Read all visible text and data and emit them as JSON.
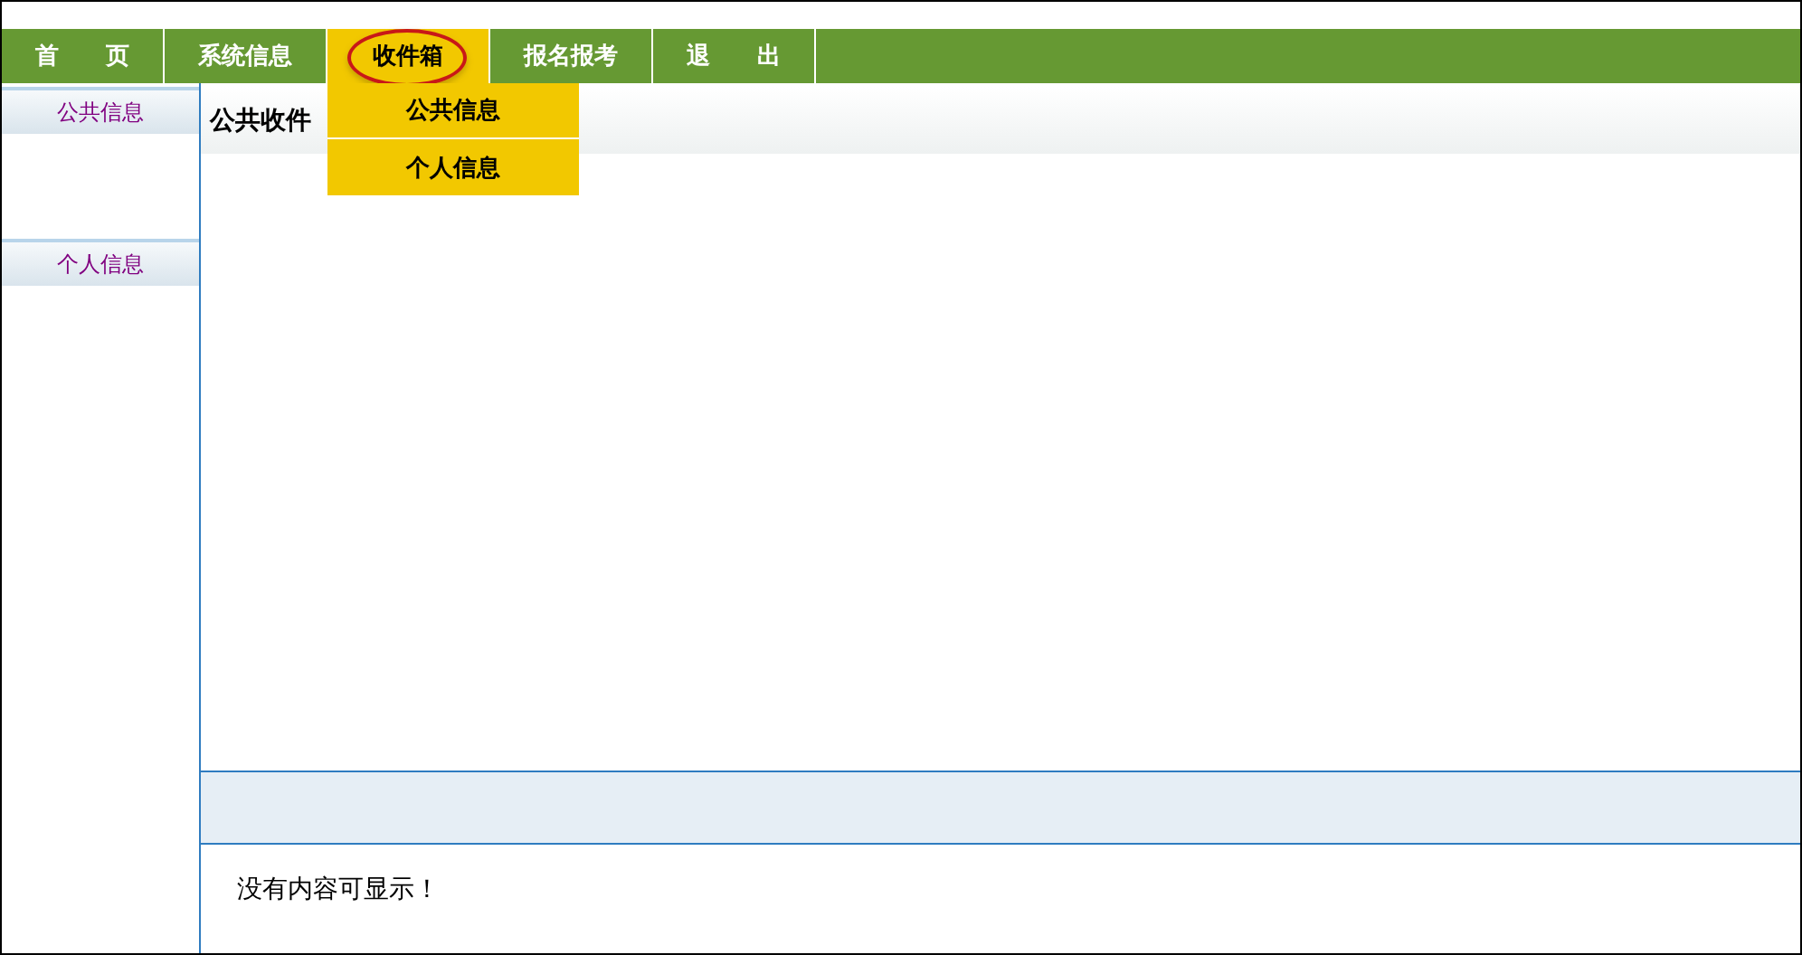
{
  "nav": {
    "items": [
      {
        "label": "首　　页",
        "selected": false
      },
      {
        "label": "系统信息",
        "selected": false
      },
      {
        "label": "收件箱",
        "selected": true
      },
      {
        "label": "报名报考",
        "selected": false
      },
      {
        "label": "退　　出",
        "selected": false
      }
    ],
    "dropdown": [
      "公共信息",
      "个人信息"
    ]
  },
  "sidebar": {
    "items": [
      "公共信息",
      "个人信息"
    ]
  },
  "main": {
    "title": "公共收件",
    "empty_message": "没有内容可显示！"
  }
}
